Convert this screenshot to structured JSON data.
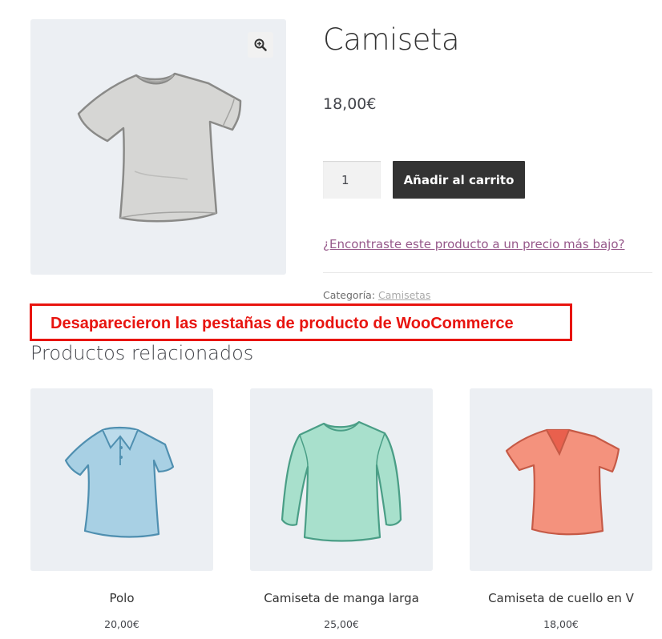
{
  "product": {
    "title": "Camiseta",
    "price": "18,00€",
    "quantity": "1",
    "add_to_cart_label": "Añadir al carrito",
    "lower_price_link": "¿Encontraste este producto a un precio más bajo?",
    "category_label": "Categoría:",
    "category_value": "Camisetas",
    "image_icon": "tshirt-grey-icon",
    "zoom_icon": "magnifier-zoom-icon"
  },
  "annotation": {
    "text": "Desaparecieron las pestañas de producto de WooCommerce",
    "color": "#e8140f"
  },
  "related": {
    "title": "Productos relacionados",
    "items": [
      {
        "name": "Polo",
        "price": "20,00€",
        "icon": "polo-shirt-blue-icon"
      },
      {
        "name": "Camiseta de manga larga",
        "price": "25,00€",
        "icon": "longsleeve-green-icon"
      },
      {
        "name": "Camiseta de cuello en V",
        "price": "18,00€",
        "icon": "vneck-coral-icon"
      }
    ]
  },
  "colors": {
    "primary_button": "#333333",
    "link": "#96588a",
    "image_background": "#eceff3"
  }
}
